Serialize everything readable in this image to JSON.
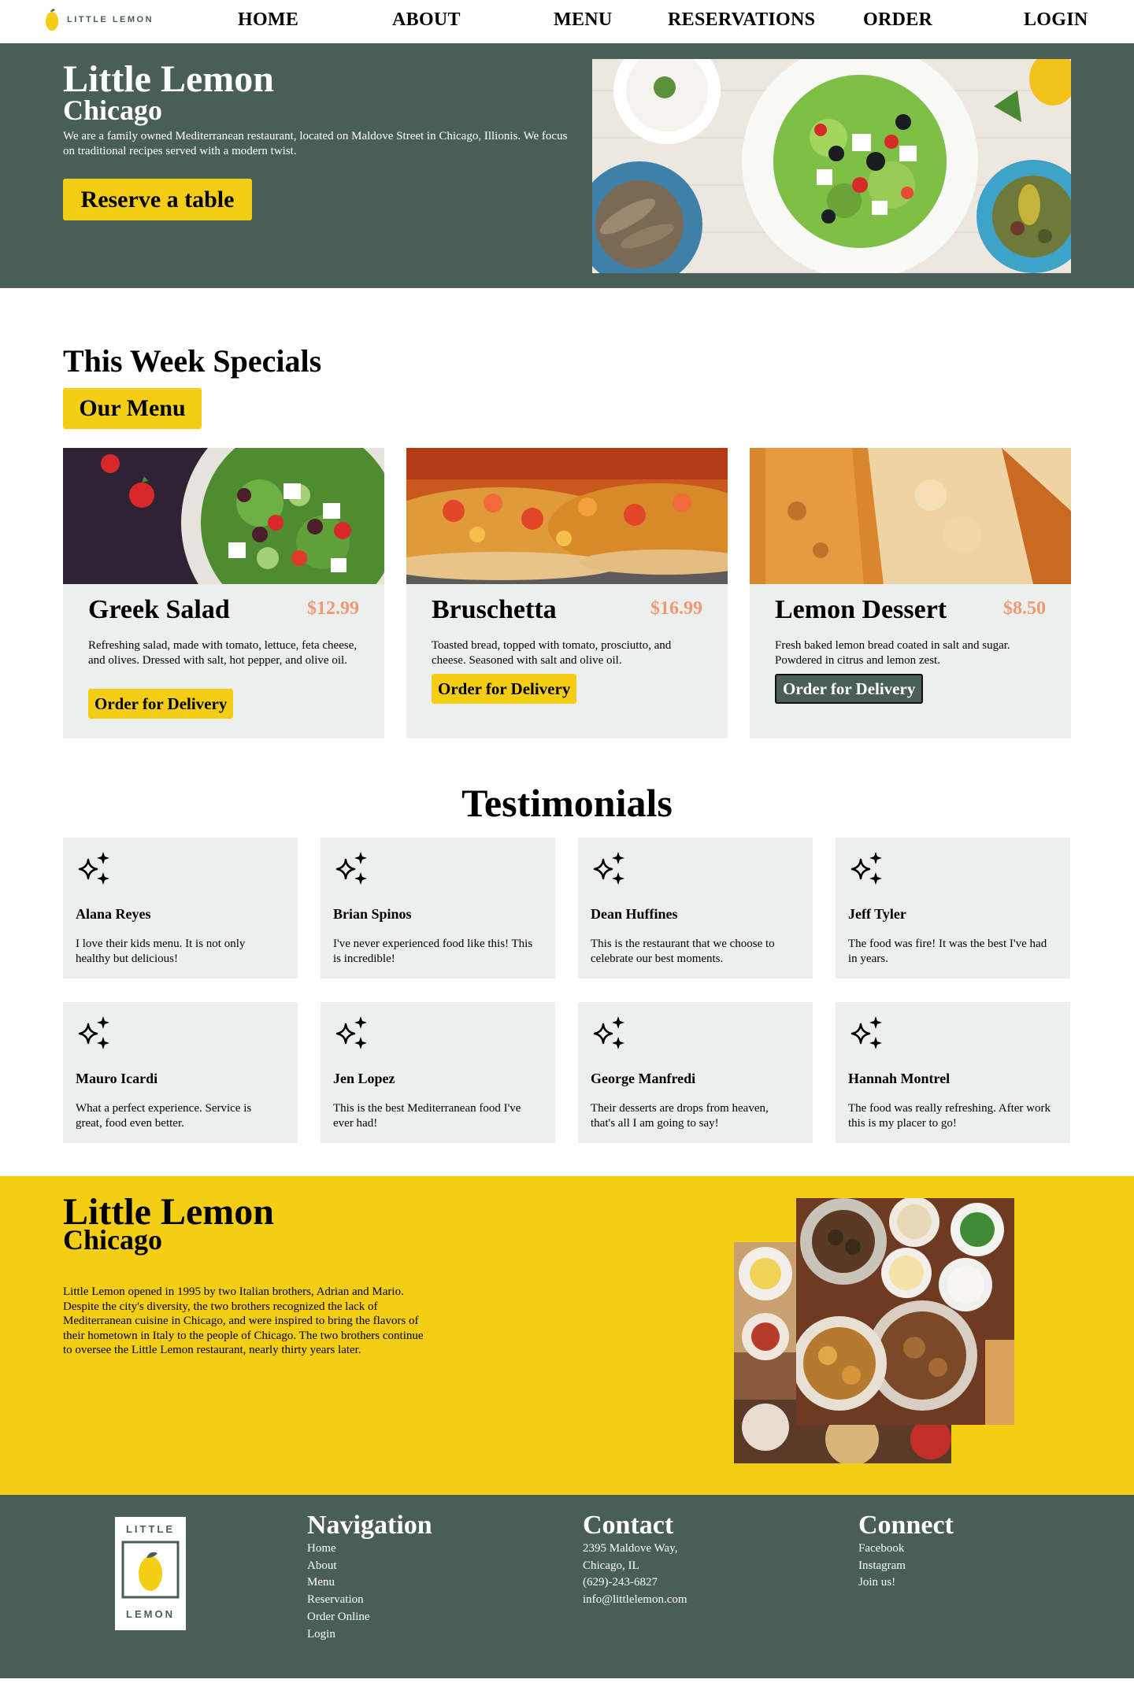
{
  "nav": {
    "logo_text": "LITTLE LEMON",
    "items": [
      "HOME",
      "ABOUT",
      "MENU",
      "RESERVATIONS",
      "ORDER",
      "LOGIN"
    ]
  },
  "hero": {
    "title": "Little Lemon",
    "subtitle": "Chicago",
    "description": "We are a family owned Mediterranean restaurant, located on Maldove Street in Chicago, Illionis. We focus on traditional recipes served with a modern twist.",
    "cta_label": "Reserve a table"
  },
  "specials": {
    "heading": "This Week Specials",
    "menu_button": "Our Menu",
    "items": [
      {
        "name": "Greek Salad",
        "price": "$12.99",
        "description": "Refreshing salad, made with tomato, lettuce, feta cheese, and olives. Dressed with salt, hot pepper, and olive oil.",
        "button": "Order for Delivery"
      },
      {
        "name": "Bruschetta",
        "price": "$16.99",
        "description": "Toasted bread, topped with tomato, prosciutto, and cheese. Seasoned with salt and olive oil.",
        "button": "Order for Delivery"
      },
      {
        "name": "Lemon Dessert",
        "price": "$8.50",
        "description": "Fresh baked lemon bread coated in salt and sugar. Powdered in citrus and lemon zest.",
        "button": "Order for Delivery"
      }
    ]
  },
  "testimonials": {
    "heading": "Testimonials",
    "icon": "sparkles-icon",
    "items": [
      {
        "name": "Alana Reyes",
        "quote": "I love their kids menu. It is not only healthy but delicious!"
      },
      {
        "name": "Brian Spinos",
        "quote": "I've never experienced food like this! This is incredible!"
      },
      {
        "name": "Dean Huffines",
        "quote": "This is the restaurant that we choose to celebrate our best moments."
      },
      {
        "name": "Jeff Tyler",
        "quote": "The food was fire! It was the best I've had in years."
      },
      {
        "name": "Mauro Icardi",
        "quote": "What a perfect experience. Service is great, food even better."
      },
      {
        "name": "Jen Lopez",
        "quote": "This is the best Mediterranean food I've ever had!"
      },
      {
        "name": "George Manfredi",
        "quote": "Their desserts are drops from heaven, that's all I am going to say!"
      },
      {
        "name": "Hannah Montrel",
        "quote": "The food was really refreshing. After work this is my placer to go!"
      }
    ]
  },
  "about": {
    "title": "Little Lemon",
    "subtitle": "Chicago",
    "text": "Little Lemon opened in 1995 by two Italian brothers, Adrian and Mario. Despite the city's diversity, the two brothers recognized the lack of Mediterranean cuisine in Chicago, and were inspired to bring the flavors of their hometown in Italy to the people of Chicago. The two brothers continue to oversee the Little Lemon restaurant, nearly thirty years later."
  },
  "footer": {
    "logo_top": "LITTLE",
    "logo_bottom": "LEMON",
    "navigation": {
      "heading": "Navigation",
      "links": [
        "Home",
        "About",
        "Menu",
        "Reservation",
        "Order Online",
        "Login"
      ]
    },
    "contact": {
      "heading": "Contact",
      "lines": [
        "2395 Maldove Way,",
        "Chicago, IL",
        "(629)-243-6827",
        "info@littlelemon.com"
      ]
    },
    "connect": {
      "heading": "Connect",
      "links": [
        "Facebook",
        "Instagram",
        "Join us!"
      ]
    }
  },
  "colors": {
    "primary_green": "#495E57",
    "primary_yellow": "#F4CE14",
    "price_salmon": "#EE9972",
    "card_gray": "#EDEFEE"
  }
}
